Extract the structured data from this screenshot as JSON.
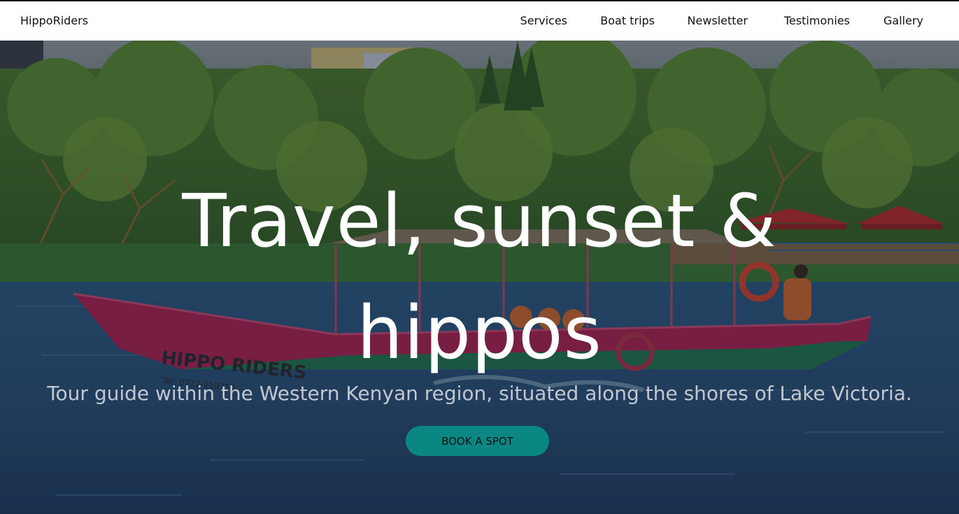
{
  "header": {
    "brand": "HippoRiders",
    "nav": [
      "Services",
      "Boat trips",
      "Newsletter",
      "Testimonies",
      "Gallery"
    ]
  },
  "hero": {
    "headline_line1": "Travel, sunset &",
    "headline_line2": "hippos",
    "tagline": "Tour guide within the Western Kenyan region, situated along the shores of Lake Victoria.",
    "cta_label": "BOOK A SPOT",
    "boat_hull_text": "HIPPO RIDERS",
    "boat_phone_text": "Tel: 0722-119350"
  },
  "colors": {
    "cta_background": "#0a8783",
    "nav_background": "#ffffff",
    "headline_text": "#ffffff",
    "tagline_text": "#c2c8d0"
  }
}
